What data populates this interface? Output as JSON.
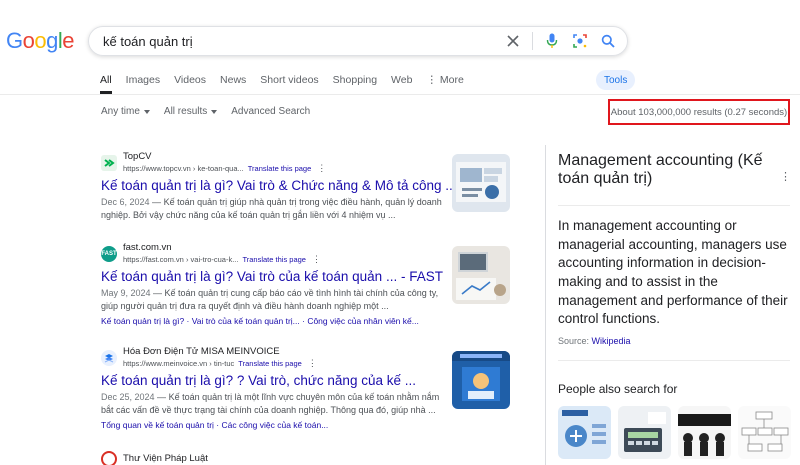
{
  "logo": {
    "letters": [
      "G",
      "o",
      "o",
      "g",
      "l",
      "e"
    ],
    "colors": [
      "#4285f4",
      "#ea4335",
      "#fbbc05",
      "#4285f4",
      "#34a853",
      "#ea4335"
    ]
  },
  "search": {
    "query": "kế toán quản trị"
  },
  "tabs": [
    {
      "label": "All",
      "active": true
    },
    {
      "label": "Images"
    },
    {
      "label": "Videos"
    },
    {
      "label": "News"
    },
    {
      "label": "Short videos"
    },
    {
      "label": "Shopping"
    },
    {
      "label": "Web"
    },
    {
      "label": "More"
    }
  ],
  "tools_label": "Tools",
  "filters": {
    "time": "Any time",
    "results": "All results",
    "advanced": "Advanced Search"
  },
  "result_stats": "About 103,000,000 results (0.27 seconds)",
  "results": [
    {
      "site_name": "TopCV",
      "url": "https://www.topcv.vn › ke-toan-qua...",
      "translate": "Translate this page",
      "title": "Kế toán quản trị là gì? Vai trò & Chức năng & Mô tả công ...",
      "date": "Dec 6, 2024",
      "snippet": "Kế toán quản trị giúp nhà quản trị trong việc điều hành, quản lý doanh nghiệp. Bởi vậy chức năng của kế toán quản trị gắn liền với 4 nhiệm vụ ...",
      "links": ""
    },
    {
      "site_name": "fast.com.vn",
      "url": "https://fast.com.vn › vai-tro-cua-k...",
      "translate": "Translate this page",
      "title": "Kế toán quản trị là gì? Vai trò của kế toán quản ... - FAST",
      "date": "May 9, 2024",
      "snippet": "Kế toán quản trị cung cấp báo cáo về tình hình tài chính của công ty, giúp người quản trị đưa ra quyết định và điều hành doanh nghiệp một ...",
      "links": "Kế toán quản trị là gì? · Vai trò của kế toán quản trị... · Công việc của nhân viên kế..."
    },
    {
      "site_name": "Hóa Đơn Điện Tử MISA MEINVOICE",
      "url": "https://www.meinvoice.vn › tin-tuc",
      "translate": "Translate this page",
      "title": "Kế toán quản trị là gì? ? Vai trò, chức năng của kế ...",
      "date": "Dec 25, 2024",
      "snippet": "Kế toán quản trị là một lĩnh vực chuyên môn của kế toán nhằm nắm bắt các vấn đề về thực trạng tài chính của doanh nghiệp. Thông qua đó, giúp nhà ...",
      "links": "Tổng quan về kế toán quản trị · Các công việc của kế toán..."
    },
    {
      "site_name": "Thư Viện Pháp Luật"
    }
  ],
  "knowledge_panel": {
    "title": "Management accounting (Kế toán quản trị)",
    "description": "In management accounting or managerial accounting, managers use accounting information in decision-making and to assist in the management and performance of their control functions.",
    "source_label": "Source:",
    "source_link": "Wikipedia",
    "people_also_search": "People also search for"
  },
  "colors": {
    "link": "#1a0dab",
    "highlight_border": "#e0161d",
    "accent": "#1a73e8"
  },
  "icons": [
    "clear-icon",
    "mic-icon",
    "lens-icon",
    "search-icon",
    "kebab-icon"
  ]
}
